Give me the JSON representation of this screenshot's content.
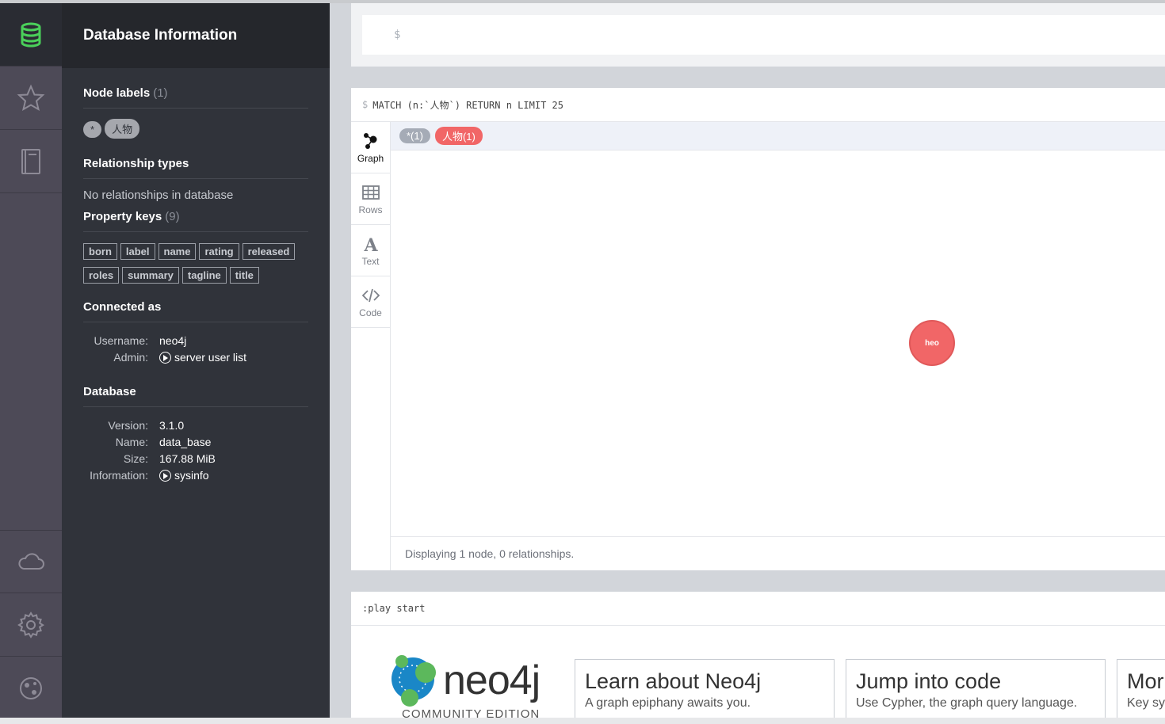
{
  "drawer": {
    "title": "Database Information",
    "node_labels": {
      "heading": "Node labels",
      "count": "(1)",
      "items": [
        "*",
        "人物"
      ]
    },
    "relationship_types": {
      "heading": "Relationship types",
      "empty_text": "No relationships in database"
    },
    "property_keys": {
      "heading": "Property keys",
      "count": "(9)",
      "items": [
        "born",
        "label",
        "name",
        "rating",
        "released",
        "roles",
        "summary",
        "tagline",
        "title"
      ]
    },
    "connected_as": {
      "heading": "Connected as",
      "username_label": "Username:",
      "username": "neo4j",
      "admin_label": "Admin:",
      "admin_link": "server user list"
    },
    "database": {
      "heading": "Database",
      "version_label": "Version:",
      "version": "3.1.0",
      "name_label": "Name:",
      "name": "data_base",
      "size_label": "Size:",
      "size": "167.88 MiB",
      "info_label": "Information:",
      "info_link": "sysinfo"
    }
  },
  "rail": {
    "icons": [
      "database-icon",
      "star-icon",
      "book-icon",
      "cloud-icon",
      "gear-icon",
      "about-icon"
    ],
    "active_color": "#4ad05a"
  },
  "editor": {
    "prompt": "$"
  },
  "result_frame": {
    "prompt": "$",
    "query": "MATCH (n:`人物`) RETURN n LIMIT 25",
    "tabs": [
      "Graph",
      "Rows",
      "Text",
      "Code"
    ],
    "legend": [
      {
        "label": "*(1)",
        "color": "#a5abb6"
      },
      {
        "label": "人物(1)",
        "color": "#f16667"
      }
    ],
    "node_caption": "heo",
    "status": "Displaying 1 node, 0 relationships."
  },
  "play_frame": {
    "command": ":play start",
    "logo_word": "neo4j",
    "logo_edition": "COMMUNITY EDITION",
    "cards": [
      {
        "title": "Learn about Neo4j",
        "subtitle": "A graph epiphany awaits you."
      },
      {
        "title": "Jump into code",
        "subtitle": "Use Cypher, the graph query language."
      },
      {
        "title": "Mor",
        "subtitle": "Key sy"
      }
    ]
  }
}
